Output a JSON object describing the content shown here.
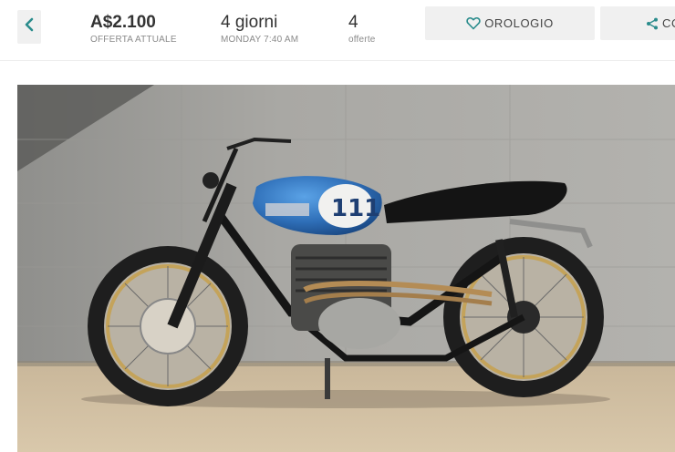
{
  "header": {
    "price": "A$2.100",
    "price_label": "OFFERTA ATTUALE",
    "time_left": "4 giorni",
    "end_time": "MONDAY 7:40 AM",
    "offers_count": "4",
    "offers_label": "offerte",
    "watch_label": "OROLOGIO",
    "share_label": "CO"
  },
  "icons": {
    "back": "chevron-left-icon",
    "watch": "heart-icon",
    "share": "share-icon"
  },
  "colors": {
    "accent": "#2a8c8c",
    "button_bg": "#f0f0f0",
    "tank_blue": "#2f6fb8"
  }
}
